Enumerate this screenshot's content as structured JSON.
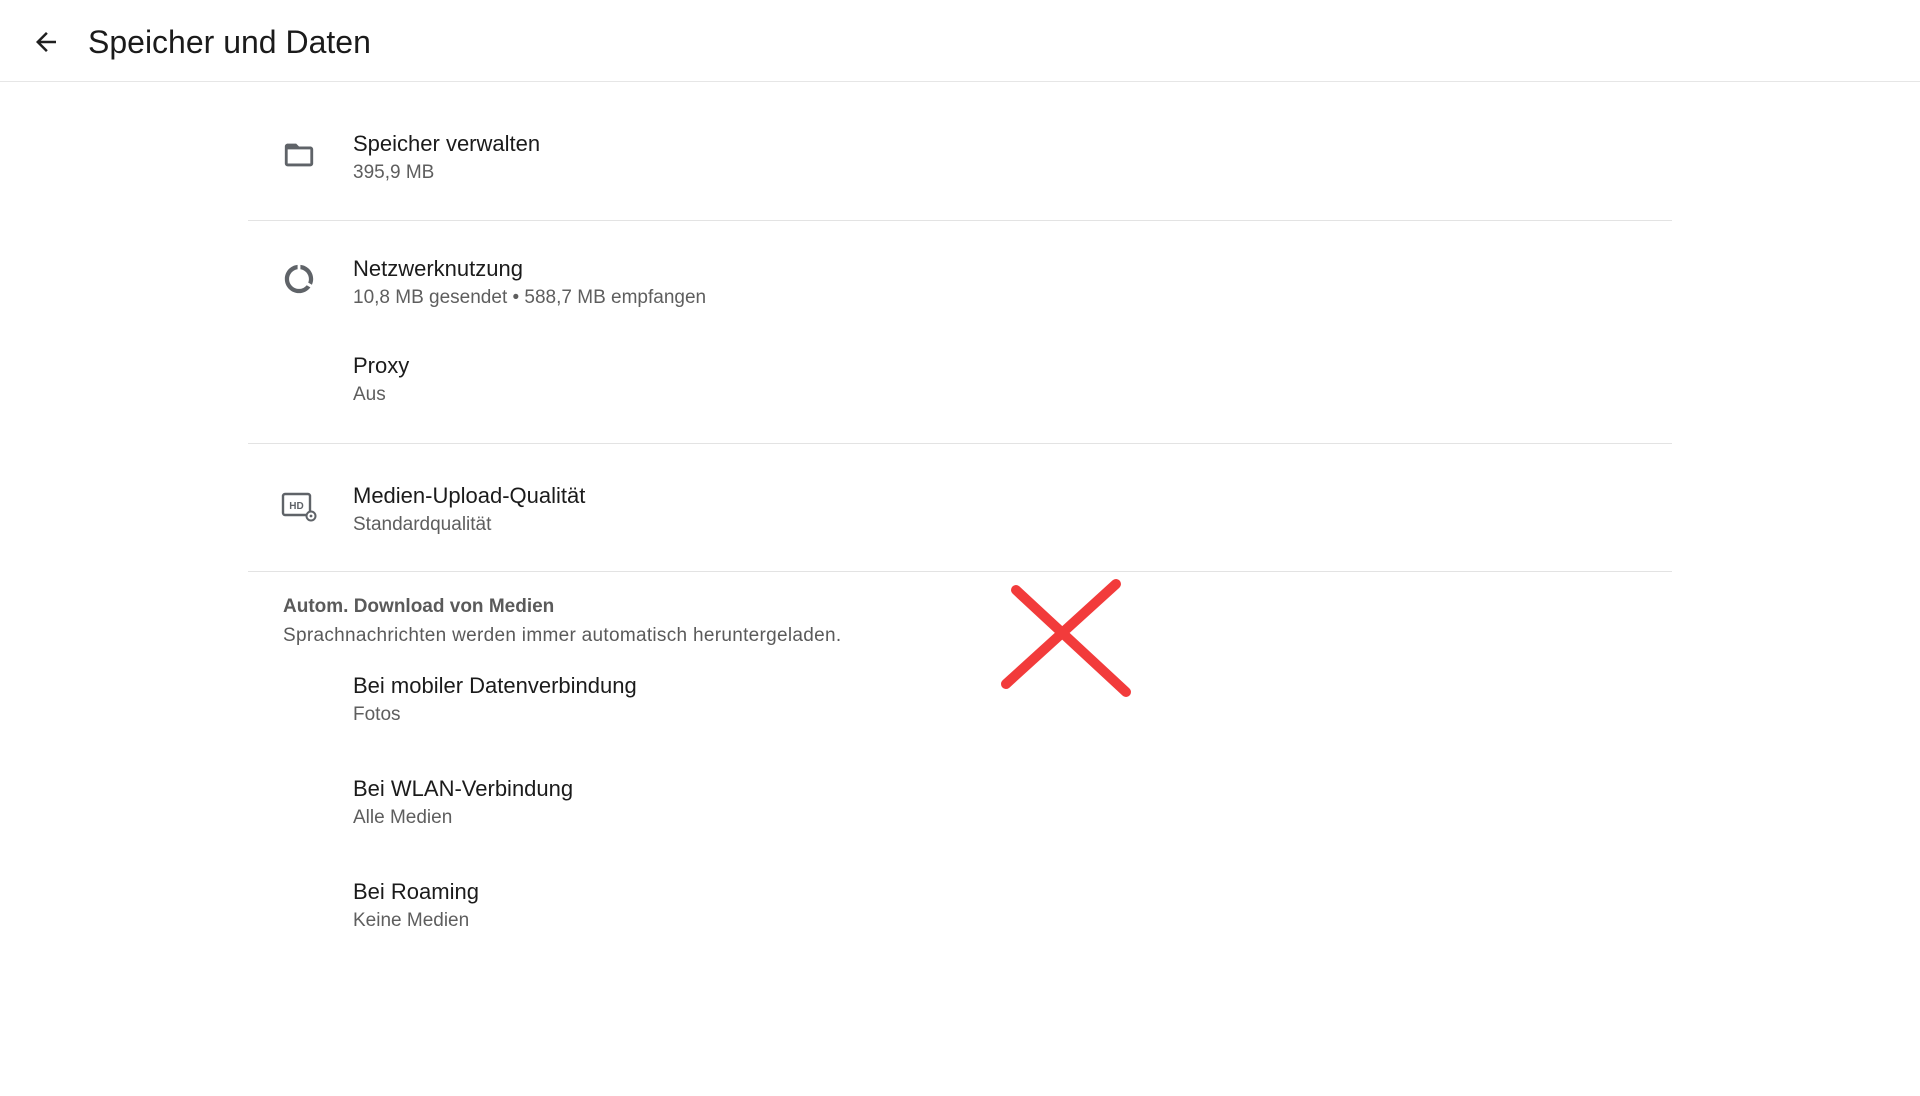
{
  "header": {
    "back_icon": "arrow-back-icon",
    "title": "Speicher und Daten"
  },
  "storage": {
    "icon": "folder-icon",
    "title": "Speicher verwalten",
    "subtitle": "395,9 MB"
  },
  "network": {
    "icon": "data-usage-icon",
    "title": "Netzwerknutzung",
    "subtitle": "10,8 MB gesendet • 588,7 MB empfangen"
  },
  "proxy": {
    "title": "Proxy",
    "subtitle": "Aus"
  },
  "media_upload": {
    "icon": "hd-settings-icon",
    "title": "Medien-Upload-Qualität",
    "subtitle": "Standardqualität"
  },
  "auto_download": {
    "section_title": "Autom. Download von Medien",
    "section_description": "Sprachnachrichten werden immer automatisch heruntergeladen.",
    "items": [
      {
        "title": "Bei mobiler Datenverbindung",
        "subtitle": "Fotos"
      },
      {
        "title": "Bei WLAN-Verbindung",
        "subtitle": "Alle Medien"
      },
      {
        "title": "Bei Roaming",
        "subtitle": "Keine Medien"
      }
    ]
  },
  "overlay": {
    "icon": "red-x-mark-icon",
    "color": "#f23b3b"
  },
  "colors": {
    "background": "#ffffff",
    "primary_text": "#1b1b1b",
    "secondary_text": "#5e5e5e",
    "divider": "#e3e3e3",
    "icon": "#5f6368"
  }
}
